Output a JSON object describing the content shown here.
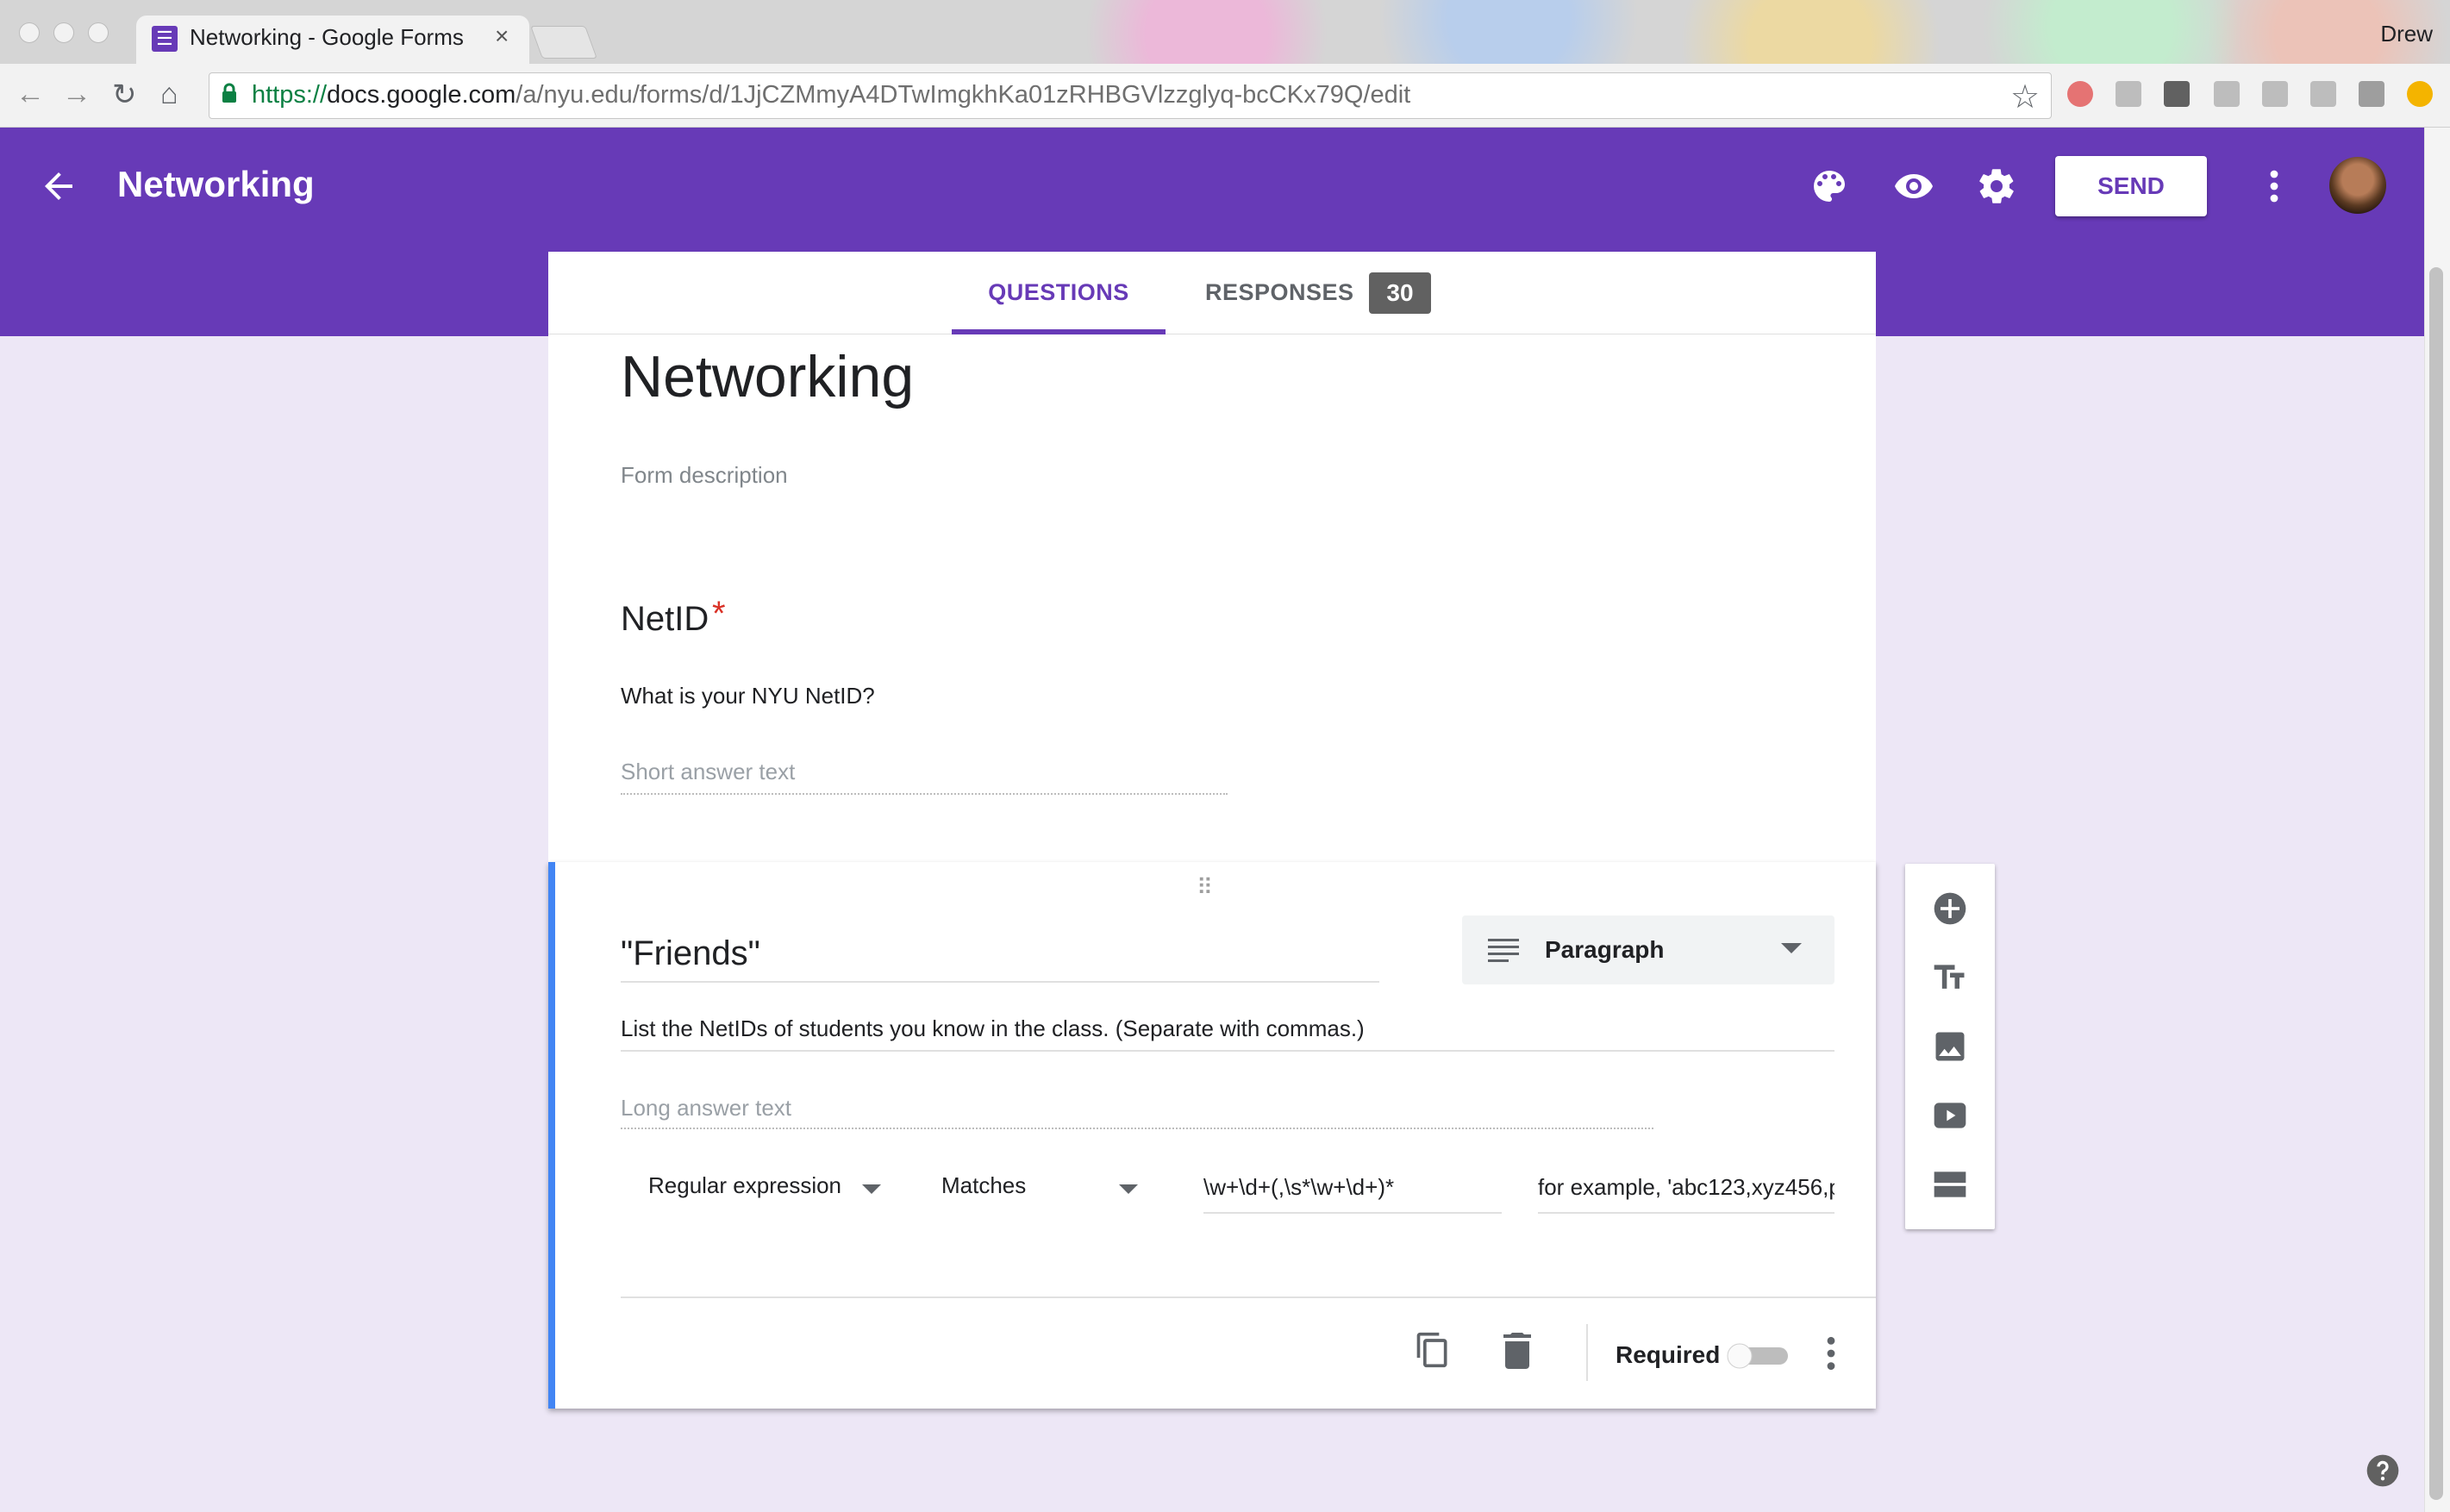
{
  "browser": {
    "tab_title": "Networking - Google Forms",
    "tab_close": "×",
    "profile_name": "Drew",
    "url_scheme": "https://",
    "url_domain": "docs.google.com",
    "url_path": "/a/nyu.edu/forms/d/1JjCZMmyA4DTwImgkhKa01zRHBGVlzzglyq-bcCKx79Q/edit",
    "nav_back": "←",
    "nav_forward": "→",
    "nav_reload": "↻",
    "nav_home": "⌂",
    "star": "☆"
  },
  "header": {
    "title": "Networking",
    "send_label": "SEND",
    "color": "#673ab7"
  },
  "tabs": {
    "questions": "QUESTIONS",
    "responses": "RESPONSES",
    "responses_count": "30"
  },
  "form": {
    "title": "Networking",
    "description_placeholder": "Form description"
  },
  "question1": {
    "title": "NetID",
    "required_mark": "*",
    "description": "What is your NYU NetID?",
    "answer_placeholder": "Short answer text"
  },
  "question2": {
    "drag_handle": "⠿",
    "title": "\"Friends\"",
    "type": "Paragraph",
    "description": "List the NetIDs of students you know in the class. (Separate with commas.)",
    "answer_placeholder": "Long answer text",
    "validation_type": "Regular expression",
    "validation_condition": "Matches",
    "validation_pattern": "\\w+\\d+(,\\s*\\w+\\d+)*",
    "validation_error": "for example, 'abc123,xyz456,p",
    "required_label": "Required",
    "required_on": false
  },
  "side_toolbar": [
    "add-question-icon",
    "add-title-icon",
    "add-image-icon",
    "add-video-icon",
    "add-section-icon"
  ]
}
